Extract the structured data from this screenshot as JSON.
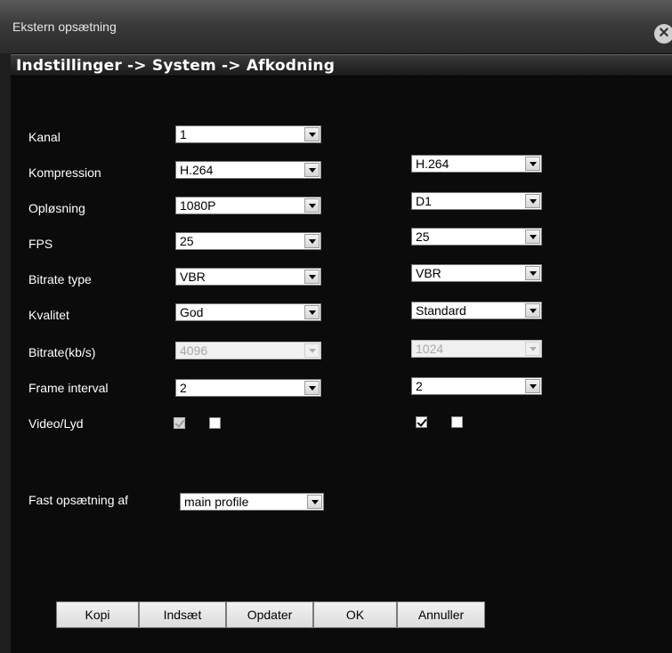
{
  "window": {
    "title": "Ekstern opsætning",
    "close_icon": "close-icon",
    "breadcrumb": "Indstillinger -> System -> Afkodning"
  },
  "labels": {
    "kanal": "Kanal",
    "kompression": "Kompression",
    "oplosning": "Opløsning",
    "fps": "FPS",
    "bitrate_type": "Bitrate type",
    "kvalitet": "Kvalitet",
    "bitrate": "Bitrate(kb/s)",
    "frame_interval": "Frame interval",
    "video_lyd": "Video/Lyd",
    "fast_opsaetning": "Fast opsætning af"
  },
  "main": {
    "kanal": "1",
    "kompression": "H.264",
    "oplosning": "1080P",
    "fps": "25",
    "bitrate_type": "VBR",
    "kvalitet": "God",
    "bitrate": "4096",
    "frame_interval": "2",
    "video_checked": true,
    "audio_checked": false
  },
  "extra": {
    "kompression": "H.264",
    "oplosning": "D1",
    "fps": "25",
    "bitrate_type": "VBR",
    "kvalitet": "Standard",
    "bitrate": "1024",
    "frame_interval": "2",
    "video_checked": true,
    "audio_checked": false
  },
  "profile": "main profile",
  "buttons": {
    "kopi": "Kopi",
    "indsaet": "Indsæt",
    "opdater": "Opdater",
    "ok": "OK",
    "annuller": "Annuller"
  }
}
